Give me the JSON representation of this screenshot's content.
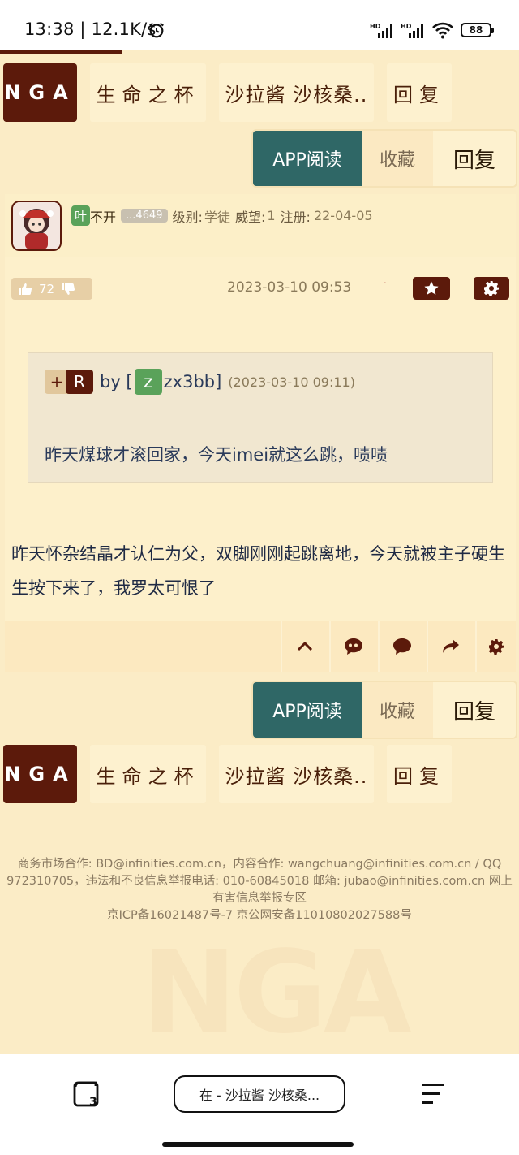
{
  "status_bar": {
    "time": "13:38 | 12.1K/s",
    "battery": "88"
  },
  "nav": {
    "logo": "NGA",
    "forum": "生命之杯",
    "thread": "沙拉酱 沙核桑..",
    "reply": "回复"
  },
  "actions": {
    "app_read": "APP阅读",
    "favorite": "收藏",
    "reply": "回复"
  },
  "post": {
    "user_badge": "叶",
    "user_name": "不开",
    "user_id": "...4649",
    "level_label": "级别:",
    "level_value": "学徒",
    "prestige_label": "威望:",
    "prestige_value": "1",
    "register_label": "注册:",
    "register_value": "22-04-05",
    "likes": "72",
    "time": "2023-03-10 09:53",
    "quote": {
      "plus": "+",
      "r": "R",
      "by": "by [",
      "user_badge": "z",
      "user_name": "zx3bb]",
      "date": "(2023-03-10 09:11)",
      "text": "昨天煤球才滚回家，今天imei就这么跳，啧啧"
    },
    "body": "昨天怀杂结晶才认仁为父，双脚刚刚起跳离地，今天就被主子硬生生按下来了，我罗太可恨了"
  },
  "footer": {
    "line1": "商务市场合作: BD@infinities.com.cn，内容合作: wangchuang@infinities.com.cn / QQ 972310705，违法和不良信息举报电话: 010-60845018 邮箱: jubao@infinities.com.cn 网上有害信息举报专区",
    "line2": "京ICP备16021487号-7 京公网安备11010802027588号",
    "watermark": "NGA"
  },
  "browser": {
    "url": "在 - 沙拉酱 沙核桑..."
  },
  "colors": {
    "accent": "#5c1a0b",
    "teal": "#2f6766",
    "background": "#fbecc6"
  }
}
